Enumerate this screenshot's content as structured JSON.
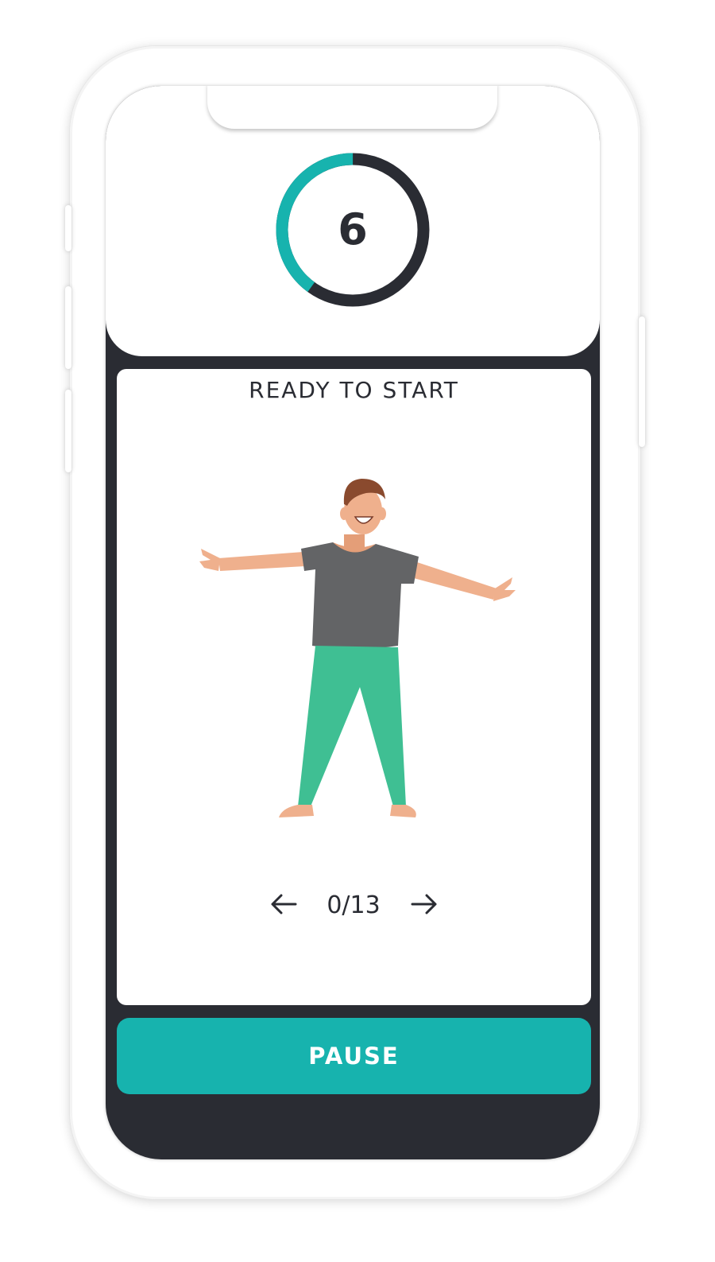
{
  "timer": {
    "value": "6",
    "progress_fraction": 0.4,
    "progress_color": "#17b3ae",
    "track_color": "#2a2c33"
  },
  "card": {
    "title": "READY TO START",
    "illustration": "man-arms-outstretched-illustration"
  },
  "pager": {
    "prev_icon": "arrow-left-icon",
    "text": "0/13",
    "next_icon": "arrow-right-icon"
  },
  "footer": {
    "pause_label": "PAUSE",
    "accent_color": "#17b3ae"
  },
  "theme": {
    "dark_background": "#2a2c33",
    "card_background": "#ffffff"
  }
}
